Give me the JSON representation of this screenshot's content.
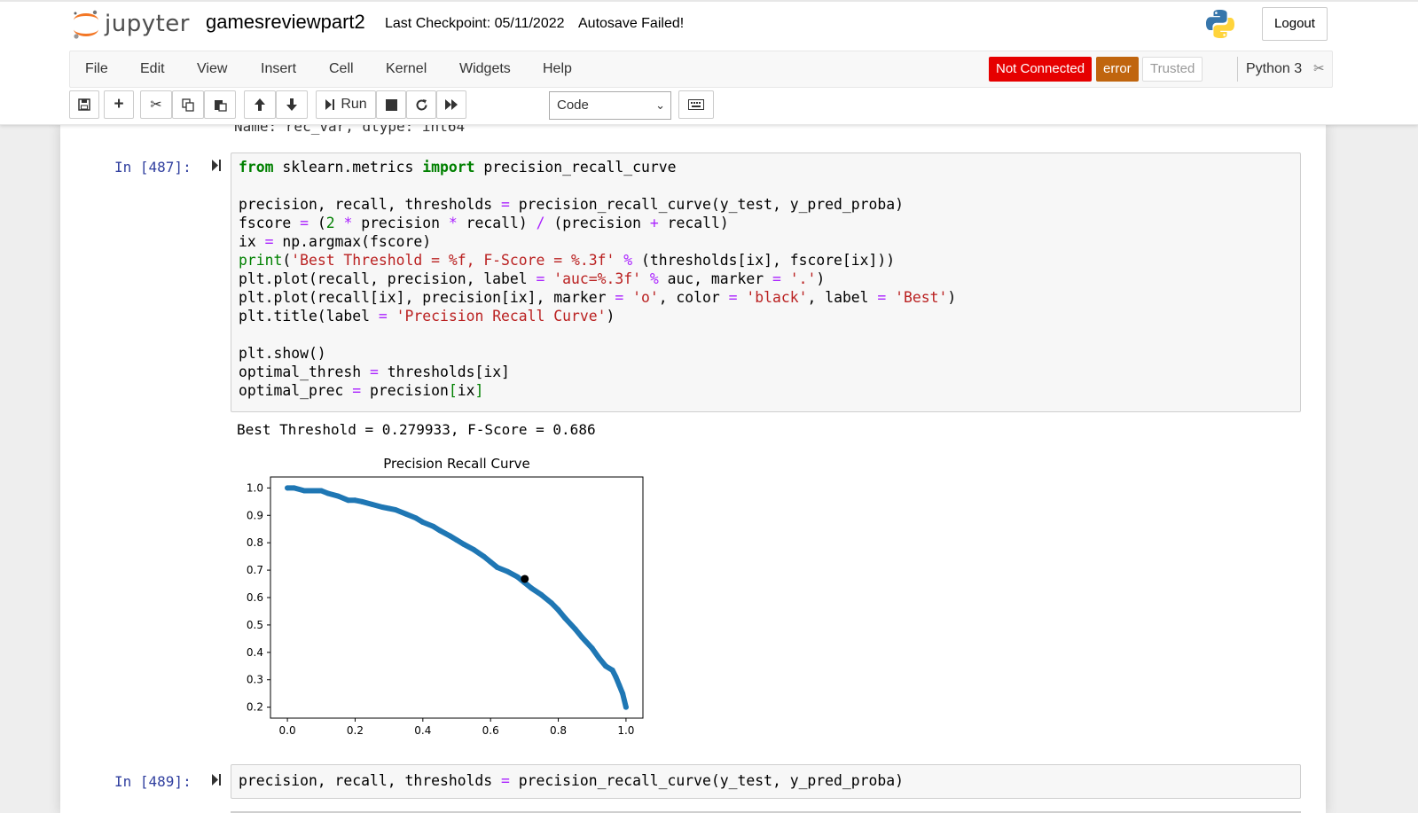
{
  "header": {
    "logo_text": "jupyter",
    "notebook_name": "gamesreviewpart2",
    "checkpoint": "Last Checkpoint: 05/11/2022",
    "autosave": "Autosave Failed!",
    "logout_label": "Logout"
  },
  "menu": {
    "items": [
      "File",
      "Edit",
      "View",
      "Insert",
      "Cell",
      "Kernel",
      "Widgets",
      "Help"
    ],
    "badges": {
      "not_connected": "Not Connected",
      "error": "error",
      "trusted": "Trusted"
    },
    "kernel_name": "Python 3"
  },
  "toolbar": {
    "run_label": "Run",
    "cell_type": "Code"
  },
  "cells": {
    "cut_line": "Name: rec_var, dtype: int64",
    "cell1": {
      "prompt": "In [487]:",
      "output": "Best Threshold = 0.279933, F-Score = 0.686"
    },
    "cell2": {
      "prompt": "In [489]:"
    }
  },
  "colors": {
    "line": "#1f77b4",
    "best": "#000000",
    "not_connected": "#e60000",
    "error_badge": "#c0650e",
    "prompt": "#303f9f"
  },
  "chart_data": {
    "type": "line",
    "title": "Precision Recall Curve",
    "xlabel": "",
    "ylabel": "",
    "xlim": [
      -0.05,
      1.05
    ],
    "ylim": [
      0.16,
      1.04
    ],
    "xticks": [
      "0.0",
      "0.2",
      "0.4",
      "0.6",
      "0.8",
      "1.0"
    ],
    "yticks": [
      "0.2",
      "0.3",
      "0.4",
      "0.5",
      "0.6",
      "0.7",
      "0.8",
      "0.9",
      "1.0"
    ],
    "series": [
      {
        "x": [
          0.0,
          0.02,
          0.05,
          0.08,
          0.1,
          0.12,
          0.15,
          0.18,
          0.2,
          0.22,
          0.25,
          0.28,
          0.3,
          0.32,
          0.35,
          0.38,
          0.4,
          0.43,
          0.45,
          0.48,
          0.5,
          0.52,
          0.55,
          0.58,
          0.6,
          0.62,
          0.65,
          0.68,
          0.7,
          0.72,
          0.75,
          0.78,
          0.8,
          0.82,
          0.85,
          0.87,
          0.9,
          0.92,
          0.94,
          0.96,
          0.97,
          0.98,
          0.99,
          1.0
        ],
        "y": [
          1.0,
          1.0,
          0.99,
          0.99,
          0.99,
          0.98,
          0.97,
          0.955,
          0.955,
          0.95,
          0.94,
          0.93,
          0.925,
          0.92,
          0.905,
          0.89,
          0.875,
          0.86,
          0.845,
          0.825,
          0.81,
          0.795,
          0.775,
          0.75,
          0.73,
          0.71,
          0.695,
          0.675,
          0.655,
          0.635,
          0.61,
          0.58,
          0.555,
          0.525,
          0.485,
          0.455,
          0.415,
          0.38,
          0.35,
          0.335,
          0.31,
          0.28,
          0.25,
          0.2
        ]
      },
      {
        "name": "Best",
        "x": [
          0.701
        ],
        "y": [
          0.668
        ]
      }
    ]
  }
}
